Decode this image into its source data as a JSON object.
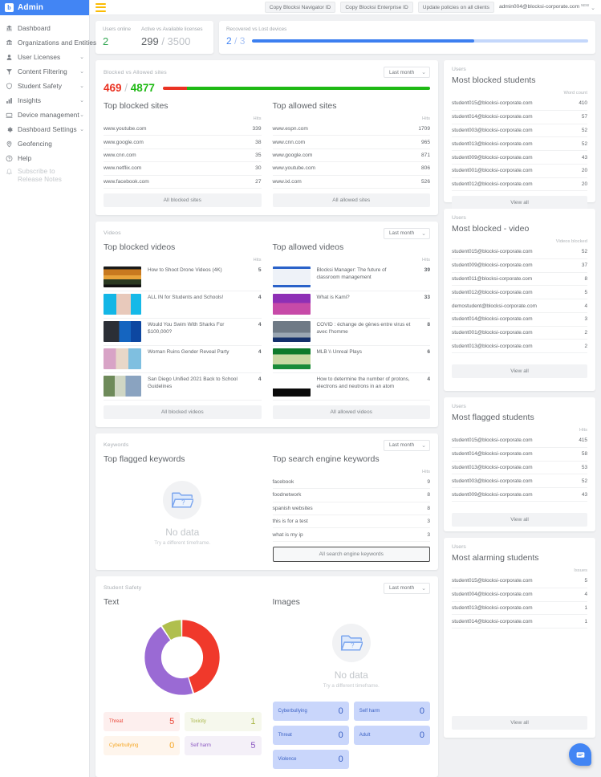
{
  "brand": {
    "logo_letter": "b",
    "title": "Admin"
  },
  "sidebar": {
    "items": [
      {
        "label": "Dashboard",
        "icon": "dashboard-icon",
        "chevron": false
      },
      {
        "label": "Organizations and Entities",
        "icon": "organizations-icon",
        "chevron": true
      },
      {
        "label": "User Licenses",
        "icon": "user-icon",
        "chevron": true
      },
      {
        "label": "Content Filtering",
        "icon": "filter-icon",
        "chevron": true
      },
      {
        "label": "Student Safety",
        "icon": "shield-icon",
        "chevron": true
      },
      {
        "label": "Insights",
        "icon": "bar-chart-icon",
        "chevron": true
      },
      {
        "label": "Device management",
        "icon": "device-icon",
        "chevron": true
      },
      {
        "label": "Dashboard Settings",
        "icon": "settings-icon",
        "chevron": true
      },
      {
        "label": "Geofencing",
        "icon": "location-pin-icon",
        "chevron": false
      },
      {
        "label": "Help",
        "icon": "help-circle-icon",
        "chevron": false
      },
      {
        "label": "Subscribe to Release Notes",
        "icon": "bell-icon",
        "chevron": false,
        "muted": true
      }
    ]
  },
  "topbar": {
    "menu_icon": "hamburger-icon",
    "buttons": [
      "Copy Blocksi Navigator ID",
      "Copy Blocksi Enterprise ID",
      "Update policies on all clients"
    ],
    "account_email": "admin004@blocksi-corporate.com",
    "account_badge": "NEW"
  },
  "stats": {
    "users_online_label": "Users online",
    "users_online_value": "2",
    "licenses_label": "Active vs Available licenses",
    "licenses_active": "299",
    "licenses_total": "3500",
    "devices_label": "Recovered vs Lost devices",
    "devices_recovered": "2",
    "devices_total": "3",
    "devices_percent": 66
  },
  "sites": {
    "kicker": "Blocked vs Allowed sites",
    "timeframe": "Last month",
    "blocked_count": "469",
    "allowed_count": "4877",
    "blocked_pct": 9,
    "blocked_color": "#ea3323",
    "allowed_color": "#1fb914",
    "blocked_title": "Top blocked sites",
    "allowed_title": "Top allowed sites",
    "hits_header": "Hits",
    "blocked_rows": [
      {
        "site": "www.youtube.com",
        "hits": "339"
      },
      {
        "site": "www.google.com",
        "hits": "38"
      },
      {
        "site": "www.cnn.com",
        "hits": "35"
      },
      {
        "site": "www.netflix.com",
        "hits": "30"
      },
      {
        "site": "www.facebook.com",
        "hits": "27"
      }
    ],
    "allowed_rows": [
      {
        "site": "www.espn.com",
        "hits": "1709"
      },
      {
        "site": "www.cnn.com",
        "hits": "965"
      },
      {
        "site": "www.google.com",
        "hits": "871"
      },
      {
        "site": "www.youtube.com",
        "hits": "806"
      },
      {
        "site": "www.ixl.com",
        "hits": "526"
      }
    ],
    "blocked_btn": "All blocked sites",
    "allowed_btn": "All allowed sites"
  },
  "users_sites": {
    "kicker": "Users",
    "title": "Most blocked students",
    "col": "Word count",
    "rows": [
      {
        "email": "student015@blocksi-corporate.com",
        "value": "410"
      },
      {
        "email": "student014@blocksi-corporate.com",
        "value": "57"
      },
      {
        "email": "student003@blocksi-corporate.com",
        "value": "52"
      },
      {
        "email": "student013@blocksi-corporate.com",
        "value": "52"
      },
      {
        "email": "student009@blocksi-corporate.com",
        "value": "43"
      },
      {
        "email": "student001@blocksi-corporate.com",
        "value": "20"
      },
      {
        "email": "student012@blocksi-corporate.com",
        "value": "20"
      }
    ],
    "btn": "View all"
  },
  "videos": {
    "kicker": "Videos",
    "timeframe": "Last month",
    "blocked_title": "Top blocked videos",
    "allowed_title": "Top allowed videos",
    "hits_header": "Hits",
    "blocked_rows": [
      {
        "title": "How to Shoot Drone Videos (4K)",
        "hits": "5",
        "thumb": "sunset-landscape"
      },
      {
        "title": "ALL IN for Students and Schools!",
        "hits": "4",
        "thumb": "woman-cyan"
      },
      {
        "title": "Would You Swim With Sharks For $100,000?",
        "hits": "4",
        "thumb": "man-blue"
      },
      {
        "title": "Woman Ruins Gender Reveal Party",
        "hits": "4",
        "thumb": "people-pink"
      },
      {
        "title": "San Diego Unified 2021 Back to School Guidelines",
        "hits": "4",
        "thumb": "classroom-green"
      }
    ],
    "allowed_rows": [
      {
        "title": "Blocksi Manager: The future of classroom management",
        "hits": "39",
        "thumb": "dashboard-blue"
      },
      {
        "title": "What is Kami?",
        "hits": "33",
        "thumb": "kami-purple"
      },
      {
        "title": "COVID : échange de gènes entre virus et avec l'homme",
        "hits": "8",
        "thumb": "news-dark"
      },
      {
        "title": "MLB \\\\ Unreal Plays",
        "hits": "6",
        "thumb": "baseball-green"
      },
      {
        "title": "How to determine the number of protons, electrons and neutrons in an atom",
        "hits": "4",
        "thumb": "whiteboard-white"
      }
    ],
    "blocked_btn": "All blocked videos",
    "allowed_btn": "All allowed videos"
  },
  "users_videos": {
    "kicker": "Users",
    "title": "Most blocked - video",
    "col": "Videos blocked",
    "rows": [
      {
        "email": "student015@blocksi-corporate.com",
        "value": "52"
      },
      {
        "email": "student009@blocksi-corporate.com",
        "value": "37"
      },
      {
        "email": "student011@blocksi-corporate.com",
        "value": "8"
      },
      {
        "email": "student012@blocksi-corporate.com",
        "value": "5"
      },
      {
        "email": "demostudent@blocksi-corporate.com",
        "value": "4"
      },
      {
        "email": "student014@blocksi-corporate.com",
        "value": "3"
      },
      {
        "email": "student001@blocksi-corporate.com",
        "value": "2"
      },
      {
        "email": "student013@blocksi-corporate.com",
        "value": "2"
      }
    ],
    "btn": "View all"
  },
  "keywords": {
    "kicker": "Keywords",
    "timeframe": "Last month",
    "flagged_title": "Top flagged keywords",
    "search_title": "Top search engine keywords",
    "hits_header": "Hits",
    "no_data_title": "No data",
    "no_data_sub": "Try a different timeframe.",
    "search_rows": [
      {
        "keyword": "facebook",
        "hits": "9"
      },
      {
        "keyword": "foodnetwork",
        "hits": "8"
      },
      {
        "keyword": "spanish websites",
        "hits": "8"
      },
      {
        "keyword": "this is for a test",
        "hits": "3"
      },
      {
        "keyword": "what is my ip",
        "hits": "3"
      }
    ],
    "btn": "All search engine keywords"
  },
  "users_keywords": {
    "kicker": "Users",
    "title": "Most flagged students",
    "col": "Hits",
    "rows": [
      {
        "email": "student015@blocksi-corporate.com",
        "value": "415"
      },
      {
        "email": "student014@blocksi-corporate.com",
        "value": "58"
      },
      {
        "email": "student013@blocksi-corporate.com",
        "value": "53"
      },
      {
        "email": "student003@blocksi-corporate.com",
        "value": "52"
      },
      {
        "email": "student009@blocksi-corporate.com",
        "value": "43"
      }
    ],
    "btn": "View all"
  },
  "safety": {
    "kicker": "Student Safety",
    "timeframe": "Last month",
    "text_title": "Text",
    "images_title": "Images",
    "no_data_title": "No data",
    "no_data_sub": "Try a different timeframe.",
    "text_chips": [
      {
        "label": "Threat",
        "value": "5",
        "bg": "#fdefee",
        "fg": "#ea4335"
      },
      {
        "label": "Toxicity",
        "value": "1",
        "bg": "#f6f8ed",
        "fg": "#a8b545"
      },
      {
        "label": "Cyberbullying",
        "value": "0",
        "bg": "#fef5ec",
        "fg": "#f5a623"
      },
      {
        "label": "Self harm",
        "value": "5",
        "bg": "#f4f0f8",
        "fg": "#8a57c1"
      }
    ],
    "image_chips": [
      {
        "label": "Cyberbullying",
        "value": "0"
      },
      {
        "label": "Self harm",
        "value": "0"
      },
      {
        "label": "Threat",
        "value": "0"
      },
      {
        "label": "Adult",
        "value": "0"
      },
      {
        "label": "Violence",
        "value": "0"
      }
    ]
  },
  "users_safety": {
    "kicker": "Users",
    "title": "Most alarming students",
    "col": "Issues",
    "rows": [
      {
        "email": "student015@blocksi-corporate.com",
        "value": "5"
      },
      {
        "email": "student004@blocksi-corporate.com",
        "value": "4"
      },
      {
        "email": "student013@blocksi-corporate.com",
        "value": "1"
      },
      {
        "email": "student014@blocksi-corporate.com",
        "value": "1"
      }
    ],
    "btn": "View all"
  },
  "chart_data": {
    "type": "pie",
    "title": "Text",
    "labels": [
      "Threat",
      "Self harm",
      "Toxicity"
    ],
    "values": [
      5,
      5,
      1
    ],
    "colors": [
      "#f0392b",
      "#9a6ad4",
      "#b0bf4d"
    ],
    "donut": true,
    "legend": "none"
  },
  "fab": {
    "icon": "chat-icon"
  }
}
